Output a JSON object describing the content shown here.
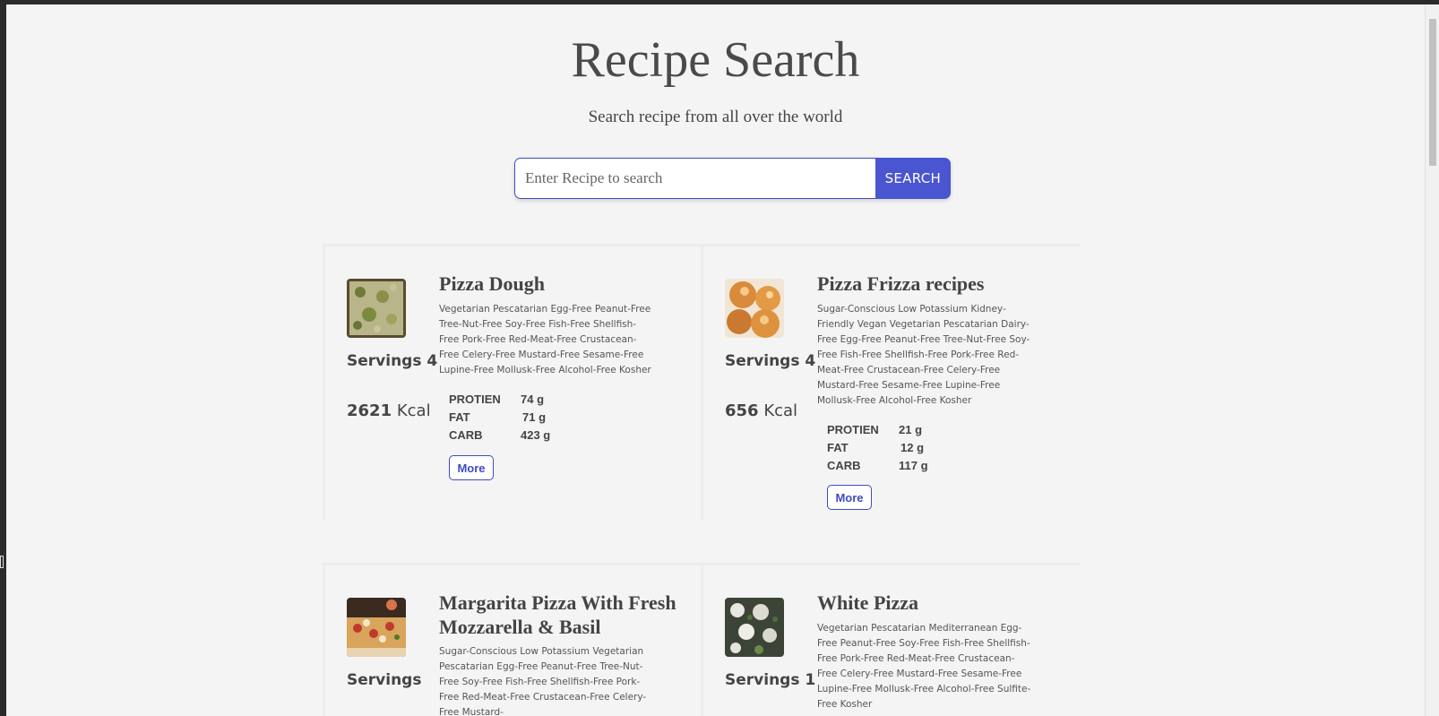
{
  "header": {
    "title": "Recipe Search",
    "subtitle": "Search recipe from all over the world"
  },
  "search": {
    "placeholder": "Enter Recipe to search",
    "value": "",
    "button_label": "SEARCH"
  },
  "colors": {
    "accent": "#4a55d1",
    "background": "#f4f4f4",
    "text": "#444444"
  },
  "nutrient_labels": {
    "protein": "PROTIEN",
    "fat": "FAT",
    "carb": "CARB"
  },
  "kcal_unit": "Kcal",
  "more_label": "More",
  "recipes": [
    {
      "title": "Pizza Dough",
      "servings": "Servings 4",
      "kcal": "2621",
      "labels": "Vegetarian Pescatarian Egg-Free Peanut-Free Tree-Nut-Free Soy-Free Fish-Free Shellfish-Free Pork-Free Red-Meat-Free Crustacean-Free Celery-Free Mustard-Free Sesame-Free Lupine-Free Mollusk-Free Alcohol-Free Kosher",
      "protein": "74 g",
      "fat": "71 g",
      "carb": "423 g",
      "image": "pizza-dough-photo"
    },
    {
      "title": "Pizza Frizza recipes",
      "servings": "Servings 4",
      "kcal": "656",
      "labels": "Sugar-Conscious Low Potassium Kidney-Friendly Vegan Vegetarian Pescatarian Dairy-Free Egg-Free Peanut-Free Tree-Nut-Free Soy-Free Fish-Free Shellfish-Free Pork-Free Red-Meat-Free Crustacean-Free Celery-Free Mustard-Free Sesame-Free Lupine-Free Mollusk-Free Alcohol-Free Kosher",
      "protein": "21 g",
      "fat": "12 g",
      "carb": "117 g",
      "image": "fried-dough-balls-photo"
    },
    {
      "title": "Margarita Pizza With Fresh Mozzarella & Basil",
      "servings": "Servings",
      "labels": "Sugar-Conscious Low Potassium Vegetarian Pescatarian Egg-Free Peanut-Free Tree-Nut-Free Soy-Free Fish-Free Shellfish-Free Pork-Free Red-Meat-Free Crustacean-Free Celery-Free Mustard-",
      "image": "margarita-pizza-photo"
    },
    {
      "title": "White Pizza",
      "servings": "Servings 1",
      "labels": "Vegetarian Pescatarian Mediterranean Egg-Free Peanut-Free Soy-Free Fish-Free Shellfish-Free Pork-Free Red-Meat-Free Crustacean-Free Celery-Free Mustard-Free Sesame-Free Lupine-Free Mollusk-Free Alcohol-Free Sulfite-Free Kosher",
      "image": "white-pizza-photo"
    }
  ]
}
